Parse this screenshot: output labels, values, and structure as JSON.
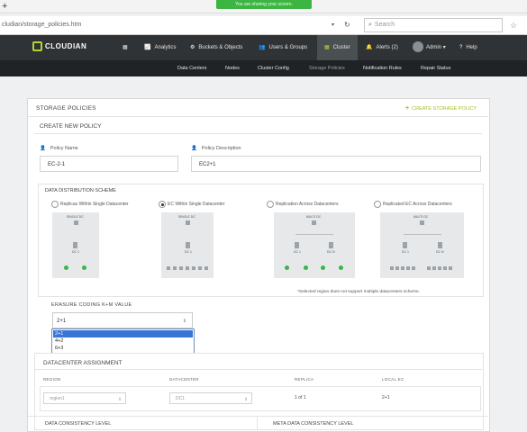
{
  "browser": {
    "share_banner": "You are sharing your screen.",
    "url": "cludian/storage_policies.htm",
    "search_placeholder": "Search"
  },
  "app": {
    "logo": "CLOUDIAN",
    "nav": {
      "analytics": "Analytics",
      "buckets": "Buckets & Objects",
      "users": "Users & Groups",
      "cluster": "Cluster",
      "alerts": "Alerts (2)",
      "admin": "Admin",
      "help": "Help"
    },
    "subnav": [
      "Data Centers",
      "Nodes",
      "Cluster Config",
      "Storage Policies",
      "Notification Rules",
      "Repair Status"
    ]
  },
  "page": {
    "title": "STORAGE POLICIES",
    "create_link": "CREATE STORAGE POLICY",
    "section_title": "CREATE NEW POLICY",
    "policy_name_label": "Policy Name",
    "policy_name_value": "EC-2-1",
    "policy_desc_label": "Policy Description",
    "policy_desc_value": "EC2+1",
    "distribution": {
      "title": "DATA DISTRIBUTION SCHEME",
      "options": [
        "Replicas Within Single Datacenter",
        "EC Within Single Datacenter",
        "Replication Across Datacenters",
        "Replicated EC Across Datacenters"
      ],
      "selected_index": 1,
      "diagram_labels": {
        "single": "SINGLE DC",
        "multi": "MULTI DC",
        "dc1": "DC 1",
        "dcn": "DC N"
      },
      "note": "*Selected region does not support multiple datacenters scheme."
    },
    "erasure": {
      "label": "ERASURE CODING K+M VALUE",
      "value": "2+1",
      "options": [
        "2+1",
        "4+2",
        "6+3"
      ],
      "highlighted_index": 0
    },
    "datacenter": {
      "title": "DATACENTER ASSIGNMENT",
      "columns": [
        "REGION",
        "DATACENTER",
        "REPLICA",
        "LOCAL EC"
      ],
      "row": {
        "region": "region1",
        "datacenter": "DC1",
        "replica": "1 of 1",
        "local_ec": "2+1"
      }
    },
    "consistency": {
      "data": "DATA CONSISTENCY LEVEL",
      "meta": "META DATA CONSISTENCY LEVEL"
    }
  }
}
